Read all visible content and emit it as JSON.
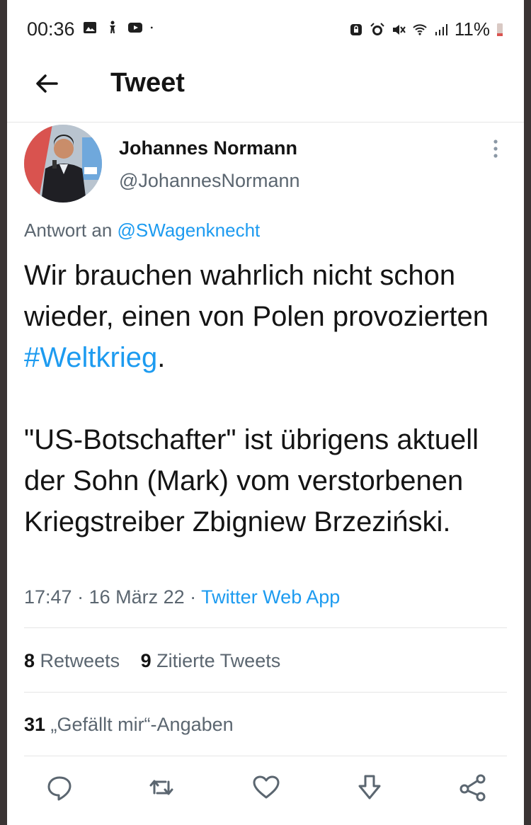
{
  "status_bar": {
    "time": "00:36",
    "battery": "11%",
    "left_icons": [
      "image-icon",
      "accessibility-icon",
      "youtube-icon",
      "dot-icon"
    ],
    "right_icons": [
      "lock-icon",
      "alarm-icon",
      "mute-icon",
      "wifi-icon",
      "signal-icon",
      "battery-icon"
    ]
  },
  "header": {
    "title": "Tweet",
    "back_icon": "back-arrow-icon"
  },
  "author": {
    "name": "Johannes Normann",
    "handle": "@JohannesNormann"
  },
  "reply": {
    "prefix": "Antwort an ",
    "mention": "@SWagenknecht"
  },
  "tweet": {
    "p1_before": "Wir brauchen wahrlich nicht schon wieder, einen von Polen provozierten ",
    "hashtag": "#Weltkrieg",
    "p1_after": ".",
    "p2": "\"US-Botschafter\" ist übrigens aktuell der Sohn (Mark) vom verstorbenen Kriegstreiber Zbigniew Brzeziński."
  },
  "meta": {
    "time": "17:47",
    "sep1": " · ",
    "date": "16 März 22",
    "sep2": " · ",
    "app": "Twitter Web App"
  },
  "stats": {
    "retweets_count": "8",
    "retweets_label": " Retweets",
    "quotes_count": "9",
    "quotes_label": " Zitierte Tweets",
    "likes_count": "31",
    "likes_label": " „Gefällt mir“-Angaben"
  },
  "actions": [
    "reply-icon",
    "retweet-icon",
    "like-icon",
    "bookmark-icon",
    "share-icon"
  ],
  "colors": {
    "accent": "#1d9bf0",
    "text": "#141414",
    "secondary": "#5b6670"
  }
}
